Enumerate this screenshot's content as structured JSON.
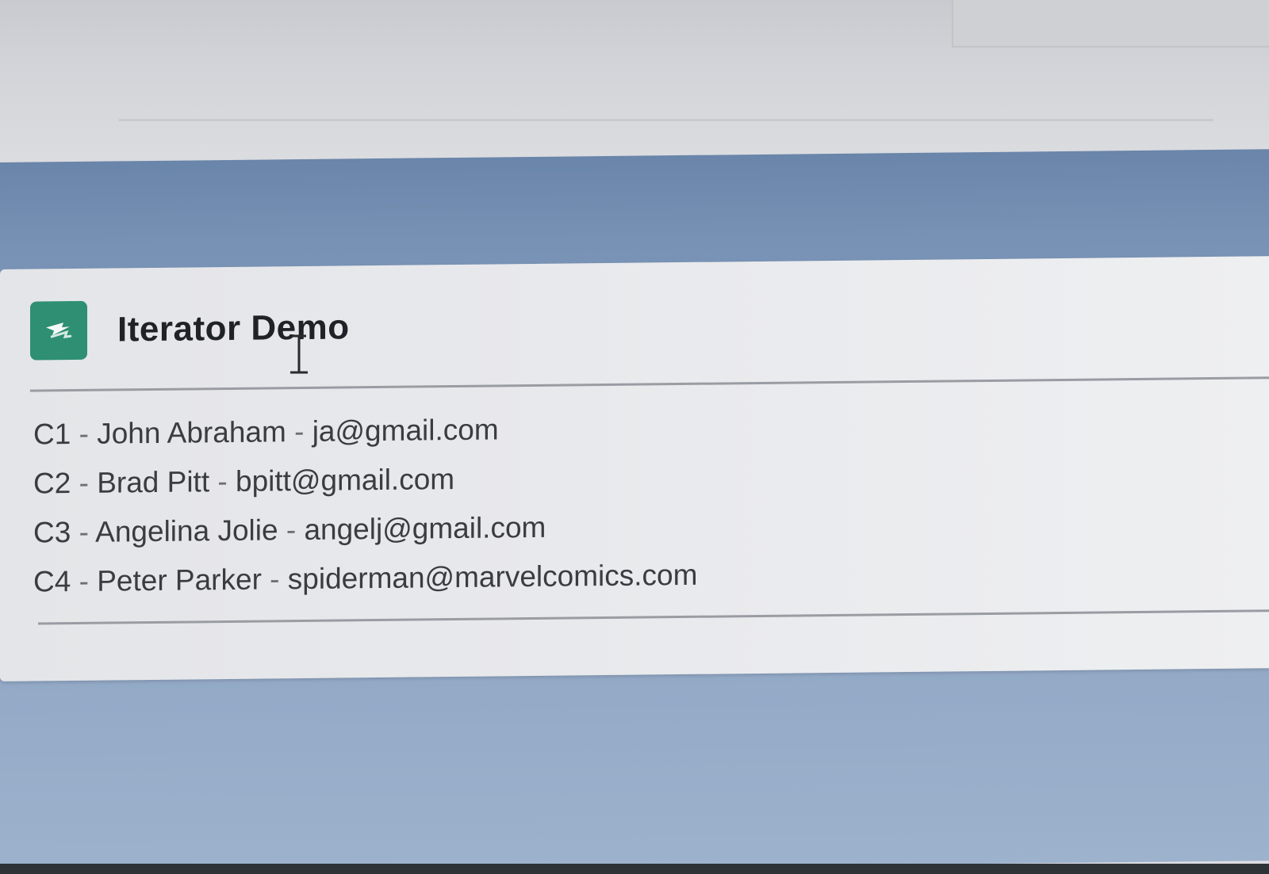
{
  "card": {
    "title": "Iterator Demo",
    "icon": "iterator-loop-icon",
    "accent_color": "#2f8f72"
  },
  "contacts": [
    {
      "id": "C1",
      "name": "John Abraham",
      "email": "ja@gmail.com"
    },
    {
      "id": "C2",
      "name": "Brad Pitt",
      "email": "bpitt@gmail.com"
    },
    {
      "id": "C3",
      "name": "Angelina Jolie",
      "email": "angelj@gmail.com"
    },
    {
      "id": "C4",
      "name": "Peter Parker",
      "email": "spiderman@marvelcomics.com"
    }
  ],
  "separator": " - ",
  "colors": {
    "background_band": "#7892b5",
    "card_background": "#e8e9ec"
  }
}
